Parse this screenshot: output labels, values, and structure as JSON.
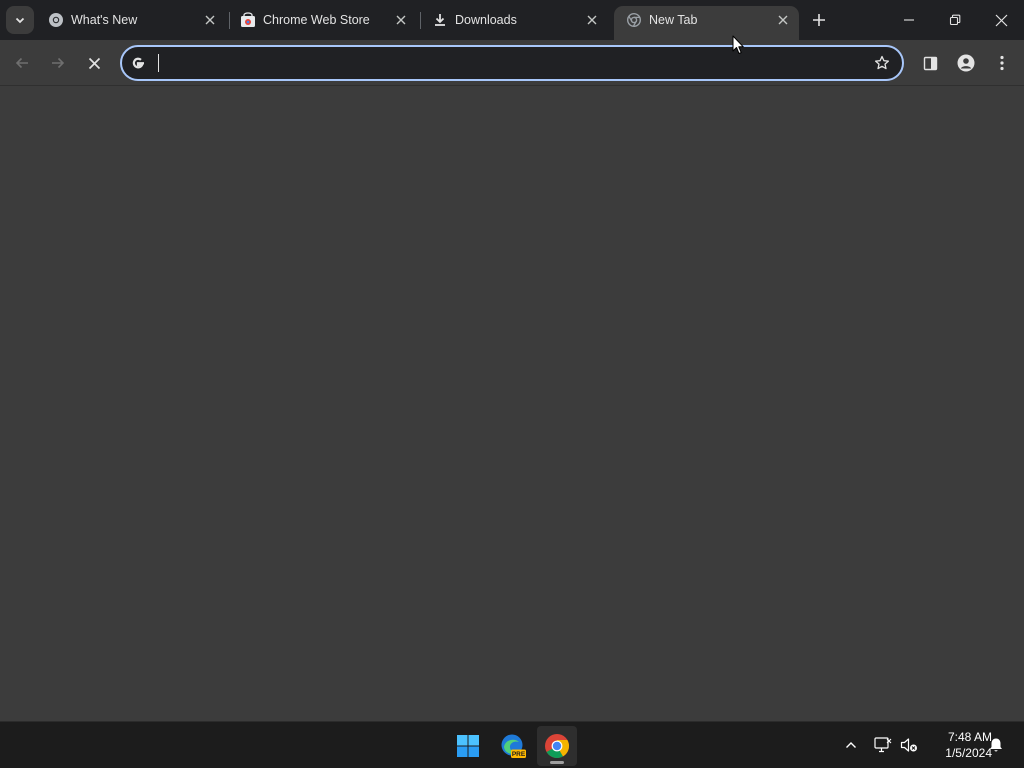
{
  "browser": {
    "tabs": [
      {
        "title": "What's New",
        "favicon": "chrome-icon",
        "active": false
      },
      {
        "title": "Chrome Web Store",
        "favicon": "web-store-icon",
        "active": false
      },
      {
        "title": "Downloads",
        "favicon": "download-icon",
        "active": false
      },
      {
        "title": "New Tab",
        "favicon": "new-tab-icon",
        "active": true
      }
    ],
    "omnibox": {
      "value": "",
      "placeholder": ""
    }
  },
  "taskbar": {
    "apps": [
      "windows-start-icon",
      "edge-preview-icon",
      "chrome-icon"
    ],
    "edge_badge": "PRE",
    "clock": {
      "time": "7:48 AM",
      "date": "1/5/2024"
    }
  },
  "colors": {
    "titlebar": "#202124",
    "toolbar": "#3c3c3c",
    "omnibox_border": "#a8c7fa",
    "taskbar": "#1c1c1c"
  }
}
